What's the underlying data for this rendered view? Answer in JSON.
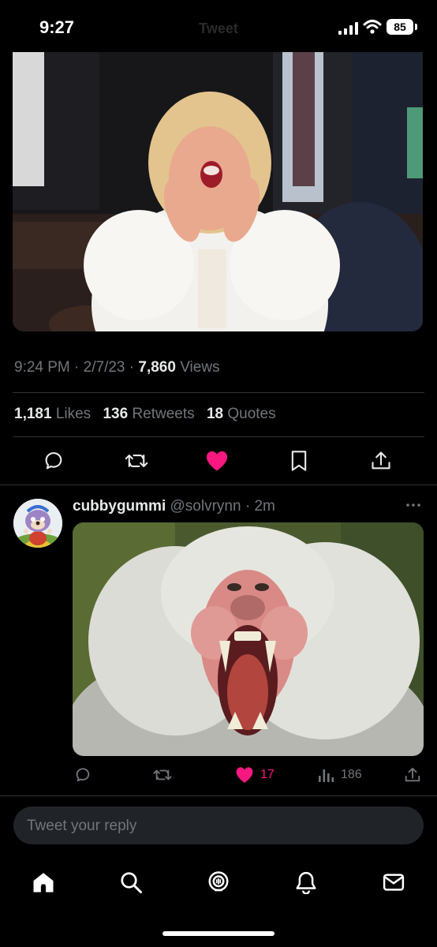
{
  "status_bar": {
    "time": "9:27",
    "title": "Tweet",
    "battery": "85",
    "icons": [
      "signal-icon",
      "wifi-icon",
      "battery-icon"
    ]
  },
  "tweet": {
    "media_icon": "photo-woman-shouting",
    "timestamp": "9:24 PM",
    "date": "2/7/23",
    "views_count": "7,860",
    "views_label": "Views",
    "likes_count": "1,181",
    "likes_label": "Likes",
    "retweets_count": "136",
    "retweets_label": "Retweets",
    "quotes_count": "18",
    "quotes_label": "Quotes",
    "actions": [
      "reply-icon",
      "retweet-icon",
      "like-icon",
      "bookmark-icon",
      "share-icon"
    ]
  },
  "reply": {
    "name": "cubbygummi",
    "handle": "@solvrynn",
    "time": "2m",
    "media_icon": "photo-baboon-yawning",
    "like_count": "17",
    "views_count": "186"
  },
  "reply_box": {
    "placeholder": "Tweet your reply"
  },
  "tabbar": {
    "items": [
      "home-icon",
      "search-icon",
      "spaces-icon",
      "notifications-icon",
      "messages-icon"
    ]
  },
  "colors": {
    "background": "#000000",
    "text": "#e7e9ea",
    "muted": "#71767b",
    "like": "#f91880",
    "divider": "#2f3336"
  }
}
